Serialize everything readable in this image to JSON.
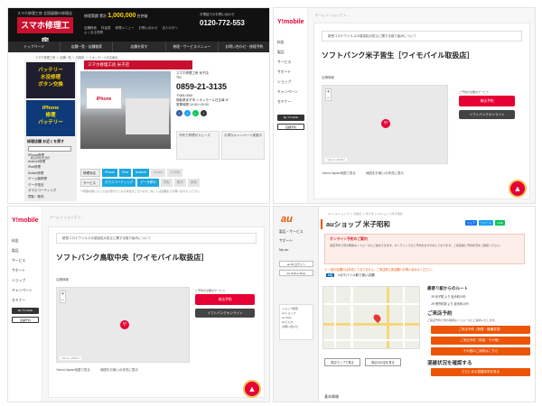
{
  "colors": {
    "smaho_red": "#c8102e",
    "ymobile_red": "#e60033",
    "au_orange": "#eb5505",
    "dark": "#111111"
  },
  "panel1": {
    "logo_sub": "スマホ修理工房 全国展開の修理店",
    "logo": "スマホ修理工房",
    "counter_label": "修理実績 累計",
    "counter_value": "1,000,000",
    "counter_unit": "台突破",
    "header_links": [
      "店舗検索",
      "料金表",
      "修理メニュー",
      "お問い合わせ",
      "法人の方へ",
      "よくある質問"
    ],
    "phone_note": "お電話でのお問い合わせ",
    "phone": "0120-772-553",
    "phone2": "0859-21-3135",
    "nav": [
      "トップページ",
      "店舗一覧・店舗検索",
      "店舗を探す",
      "修理・サービスメニュー",
      "お問い合わせ・修理予約"
    ],
    "breadcrumb": "スマホ修理工房 ＞ 店舗一覧 ＞ 鳥取県 ＞ イオンモール日吉津店",
    "banner1": "バッテリー\n水没修理\nボタン交換",
    "banner2": "iPhone\n修理\nバッテリー",
    "sidebar_title": "修理店舗  お近くを探す",
    "sidebar_select": "都道府県を選択",
    "sidebar_items": [
      "iPhone修理",
      "Android修理",
      "iPad修理",
      "Switch修理",
      "ゲーム機修理",
      "データ復旧",
      "ガラスコーティング",
      "買取・販売"
    ],
    "shop_header": "スマホ修理工房 米子店",
    "shop_sign": "iPhone",
    "info_lines": [
      "スマホ修理工房 米子店",
      "TEL"
    ],
    "address_lines": [
      "〒683-0000",
      "鳥取県米子市 イオンモール日吉津 1F",
      "営業時間 10:00〜20:00"
    ],
    "sns": [
      "f",
      "t",
      "L",
      "i"
    ],
    "promo": [
      "予約で修理がスムーズ",
      "お得なキャンペーン実施中"
    ],
    "table_rows": [
      {
        "label": "修理対応",
        "tags": [
          "iPhone",
          "iPad",
          "Android",
          "Switch",
          "その他"
        ],
        "off": [
          false,
          false,
          false,
          true,
          true
        ]
      },
      {
        "label": "サービス",
        "tags": [
          "ガラスコーティング",
          "データ移行",
          "買取",
          "販売",
          "保険"
        ],
        "off": [
          false,
          false,
          true,
          true,
          true
        ]
      }
    ],
    "note": "※修理内容によってはお預かりとなる場合がございます。詳しくは店舗までお問い合わせください。"
  },
  "ym_common": {
    "logo": "Y!mobile",
    "menu": [
      "料金",
      "製品",
      "サービス",
      "サポート",
      "ショップ",
      "キャンペーン",
      "セミナー"
    ],
    "btn_login": "My Y!mobile",
    "btn_shop": "店舗予約",
    "notice": "新型コロナウイルスの感染拡大防止に関する取り組みについて",
    "map_label": "Yahoo! JAPAN",
    "map_pin": "Y!",
    "reserve_btn": "来店予約",
    "online_btn": "ソフトバンクオンライン",
    "reserve_note": "ご予約が必要なサービス",
    "link1": "Yahoo!Japan地図で見る",
    "link2": "地図をお使いの状況に表示"
  },
  "panel2": {
    "breadcrumb": "ホーム ＞ ショップ ＞ ...",
    "title": "ソフトバンク米子皆生［ワイモバイル取扱店］",
    "sub": "店舗情報"
  },
  "panel3": {
    "breadcrumb": "ホーム ＞ ショップ ＞ ...",
    "title": "ソフトバンク鳥取中央［ワイモバイル取扱店］",
    "sub": "店舗情報"
  },
  "panel4": {
    "logo": "au",
    "menu": [
      "製品・サービス",
      "サポート",
      "My au"
    ],
    "side_buttons": [
      "au ID ログイン",
      "au Online Shop"
    ],
    "side_box": [
      "ショップ検索",
      "auショップ",
      "au Style",
      "auでんき",
      "お問い合わせ"
    ],
    "breadcrumb": "au ＞ auショップ ＞ 鳥取県 ＞ 米子市 ＞ auショップ米子昭和",
    "title": "auショップ 米子昭和",
    "social": [
      "シェア",
      "ツイート",
      "LINE"
    ],
    "alert_title": "オンライン予約のご案内",
    "alert_body": "来店予約で待ち時間なくスムーズにご案内できます。オンラインでのご予約をおすすめしております。ご来店前に予約状況をご確認ください。",
    "notice": "※ 一部の店舗では対応しておりません。ご来店前に各店舗へお問い合わせください。",
    "uq_badge": "UQ",
    "uq_text": "UQモバイル取り扱い店舗",
    "map_btns": [
      "周辺マップで見る",
      "周辺のお店を見る"
    ],
    "basic": "基本情報",
    "route_title": "最寄り駅からのルート",
    "route_lines": [
      "JR 米子駅 より 徒歩約15分",
      "JR 博労町駅 より 徒歩約10分"
    ],
    "reserve_title": "ご来店予約",
    "reserve_text": "ご来店予約で待ち時間なくスムーズにご案内いたします。",
    "reserve_buttons": [
      "ご来店予約（新規・機種変更）",
      "ご来店予約（料金・その他）",
      "その他のご用件はこちら"
    ],
    "status_title": "混雑状況を確認する",
    "status_btn": "ただいまの混雑状況を見る"
  }
}
